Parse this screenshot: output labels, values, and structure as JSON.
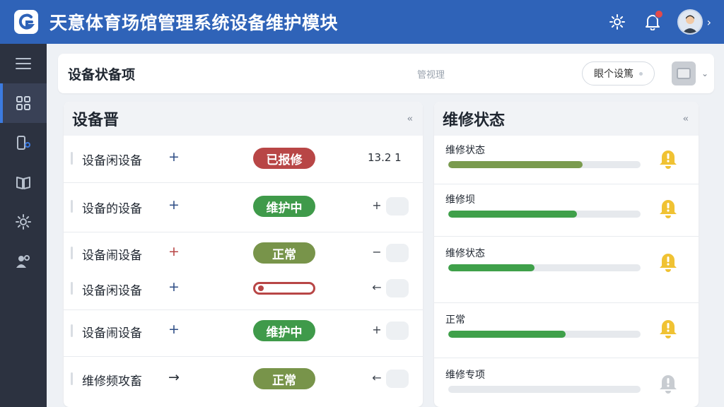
{
  "app": {
    "title": "天意体育场馆管理系统设备维护模块"
  },
  "header": {
    "icons": [
      "settings-icon",
      "bell-icon",
      "user-avatar"
    ],
    "notification_dot": true
  },
  "sidebar": {
    "items": [
      {
        "icon": "menu-icon",
        "active": false
      },
      {
        "icon": "dashboard-icon",
        "active": true
      },
      {
        "icon": "device-icon",
        "active": false
      },
      {
        "icon": "book-icon",
        "active": false
      },
      {
        "icon": "gear-icon",
        "active": false
      },
      {
        "icon": "users-icon",
        "active": false
      }
    ]
  },
  "toolbar": {
    "page_title": "设备状备项",
    "view_label": "管视理",
    "filter_label": "眼个设篤"
  },
  "equipment_panel": {
    "title": "设备晋",
    "collapse_icon": "collapse-icon",
    "rows": [
      {
        "name": "设备闲设备",
        "action": "+",
        "action_color": "#2f4e86",
        "status": "已报修",
        "status_style": "red",
        "value": "13.2",
        "value2": "1"
      },
      {
        "name": "设备的设备",
        "action": "+",
        "action_color": "#2f4e86",
        "status": "维护中",
        "status_style": "green",
        "mini": "+"
      },
      {
        "name": "设备闹设备",
        "action": "+",
        "action_color": "#b84646",
        "status": "正常",
        "status_style": "olive",
        "mini": "−"
      },
      {
        "name": "设备闲设备",
        "action": "+",
        "action_color": "#2f4e86",
        "status": "",
        "status_style": "outline",
        "mini": "←"
      },
      {
        "name": "设备闹设备",
        "action": "+",
        "action_color": "#2f4e86",
        "status": "维护中",
        "status_style": "green",
        "mini": "+"
      },
      {
        "name": "维修频攻畜",
        "action": "→",
        "action_color": "#2a3038",
        "status": "正常",
        "status_style": "olive",
        "mini": "←"
      }
    ]
  },
  "maintenance_panel": {
    "title": "维修状态",
    "collapse_icon": "collapse-icon",
    "items": [
      {
        "label": "维修状态",
        "progress": 0.7,
        "color": "#7a9b4e",
        "warn": true
      },
      {
        "label": "维修坝",
        "progress": 0.67,
        "color": "#3fa04a",
        "warn": true
      },
      {
        "label": "维修状态",
        "progress": 0.45,
        "color": "#3fa04a",
        "warn": true
      },
      {
        "label": "正常",
        "progress": 0.61,
        "color": "#3fa04a",
        "warn": true
      },
      {
        "label": "维修专项",
        "progress": 0.0,
        "color": "#3fa04a",
        "warn": false
      }
    ]
  },
  "colors": {
    "header_bg": "#2f63b8",
    "sidebar_bg": "#2c3240",
    "accent": "#3c7be0",
    "warn_yellow": "#f0c233",
    "warn_gray": "#c8ccd1"
  }
}
